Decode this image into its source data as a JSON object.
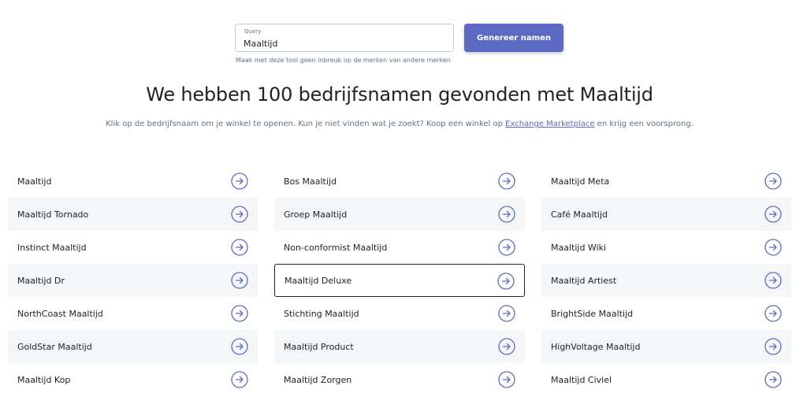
{
  "search": {
    "label": "Query",
    "value": "Maaltijd",
    "button_label": "Genereer namen",
    "disclaimer": "Maak met deze tool geen inbreuk op de merken van andere merken"
  },
  "heading": "We hebben 100 bedrijfsnamen gevonden met Maaltijd",
  "subtext": {
    "before": "Klik op de bedrijfsnaam om je winkel te openen. Kun je niet vinden wat je zoekt? Koop een winkel op",
    "link": "Exchange Marketplace",
    "after": "en krijg een voorsprong."
  },
  "colors": {
    "accent": "#5c6ac4",
    "row_shade": "#f4f6f8",
    "text": "#212326",
    "muted": "#637381"
  },
  "icons": {
    "row_arrow": "arrow-right-circle-icon"
  },
  "results": [
    {
      "name": "Maaltijd",
      "shaded": false,
      "active": false
    },
    {
      "name": "Bos Maaltijd",
      "shaded": false,
      "active": false
    },
    {
      "name": "Maaltijd Meta",
      "shaded": false,
      "active": false
    },
    {
      "name": "Maaltijd Tornado",
      "shaded": true,
      "active": false
    },
    {
      "name": "Groep Maaltijd",
      "shaded": true,
      "active": false
    },
    {
      "name": "Café Maaltijd",
      "shaded": true,
      "active": false
    },
    {
      "name": "Instinct Maaltijd",
      "shaded": false,
      "active": false
    },
    {
      "name": "Non-conformist Maaltijd",
      "shaded": false,
      "active": false
    },
    {
      "name": "Maaltijd Wiki",
      "shaded": false,
      "active": false
    },
    {
      "name": "Maaltijd Dr",
      "shaded": true,
      "active": false
    },
    {
      "name": "Maaltijd Deluxe",
      "shaded": false,
      "active": true
    },
    {
      "name": "Maaltijd Artiest",
      "shaded": true,
      "active": false
    },
    {
      "name": "NorthCoast Maaltijd",
      "shaded": false,
      "active": false
    },
    {
      "name": "Stichting Maaltijd",
      "shaded": false,
      "active": false
    },
    {
      "name": "BrightSide Maaltijd",
      "shaded": false,
      "active": false
    },
    {
      "name": "GoldStar Maaltijd",
      "shaded": true,
      "active": false
    },
    {
      "name": "Maaltijd Product",
      "shaded": true,
      "active": false
    },
    {
      "name": "HighVoltage Maaltijd",
      "shaded": true,
      "active": false
    },
    {
      "name": "Maaltijd Kop",
      "shaded": false,
      "active": false
    },
    {
      "name": "Maaltijd Zorgen",
      "shaded": false,
      "active": false
    },
    {
      "name": "Maaltijd Civiel",
      "shaded": false,
      "active": false
    }
  ]
}
